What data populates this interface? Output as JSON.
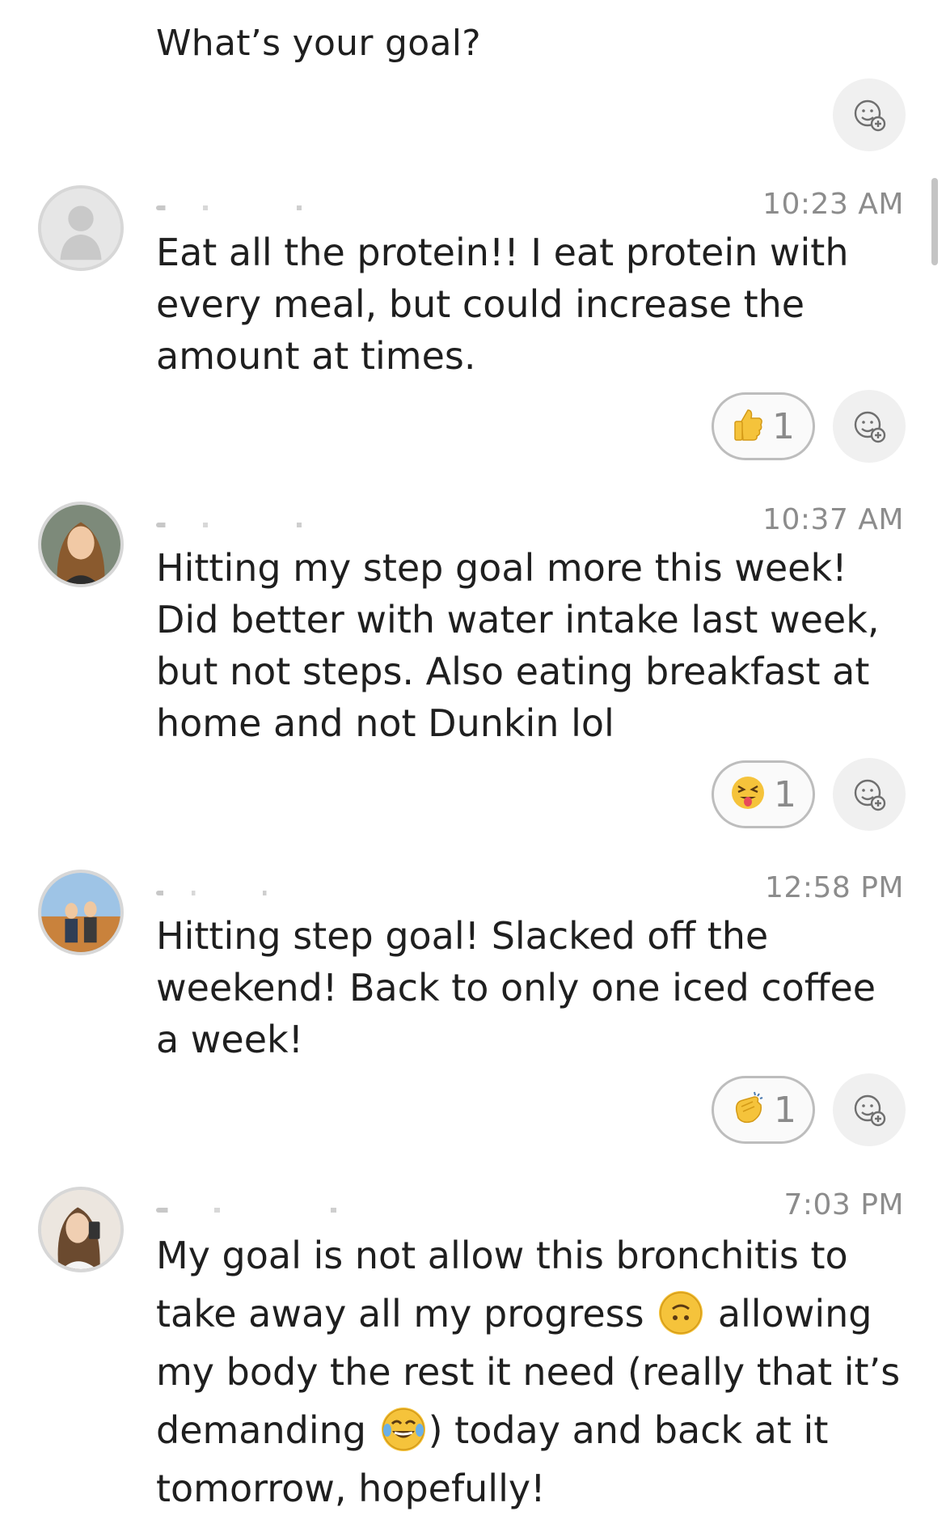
{
  "thread": {
    "question": "What’s your goal?"
  },
  "messages": [
    {
      "time": "10:23 AM",
      "text": "Eat all the protein!! I eat protein with every meal, but could increase the amount at times.",
      "reaction": {
        "icon": "thumbs-up-icon",
        "count": "1"
      }
    },
    {
      "time": "10:37 AM",
      "text": "Hitting my step goal more this week! Did better with water intake last week, but not steps. Also eating breakfast at home and not Dunkin lol",
      "reaction": {
        "icon": "squinting-tongue-face-icon",
        "count": "1"
      }
    },
    {
      "time": "12:58 PM",
      "text": "Hitting step goal! Slacked off the weekend! Back to only one iced coffee a week!",
      "reaction": {
        "icon": "clapping-hands-icon",
        "count": "1"
      }
    },
    {
      "time": "7:03 PM",
      "text_part1": "My goal is not allow this bronchitis to take away all my progress ",
      "text_part2": " allowing my body the rest it need (really that it’s demanding ",
      "text_part3": ") today and back at it tomorrow, hopefully!"
    }
  ],
  "colors": {
    "background": "#ffffff",
    "text": "#1f1f1f",
    "timestamp": "#8c8c8c",
    "emoji_yellow": "#f5c33b"
  }
}
